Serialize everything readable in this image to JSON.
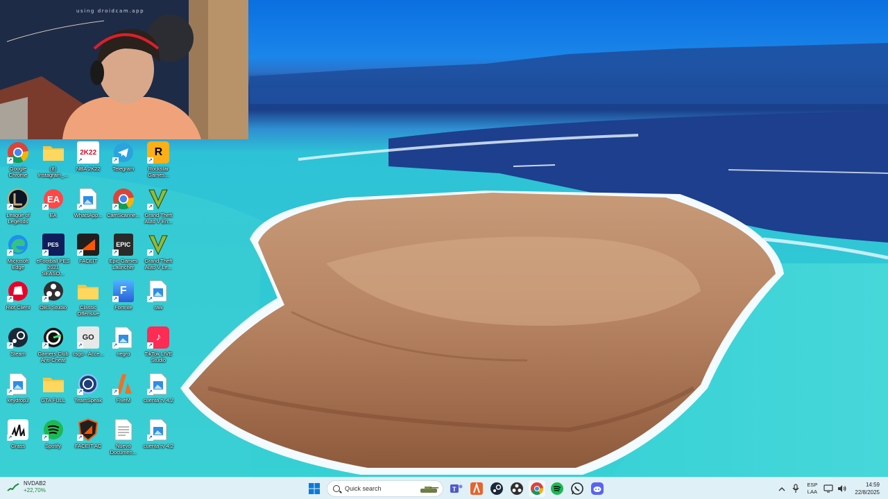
{
  "webcam": {
    "caption": "using droidcam.app"
  },
  "desktop_icons": [
    {
      "label": "Google Chrome",
      "icon": "chrome-icon"
    },
    {
      "label": "(8) Instagram_...",
      "icon": "folder-icon"
    },
    {
      "label": "NBA 2K22",
      "icon": "nba2k22-icon"
    },
    {
      "label": "Telegram",
      "icon": "telegram-icon"
    },
    {
      "label": "Rockstar Games...",
      "icon": "rockstar-icon"
    },
    {
      "label": "League of Legends",
      "icon": "league-of-legends-icon"
    },
    {
      "label": "EA",
      "icon": "ea-icon"
    },
    {
      "label": "WhatsApp...",
      "icon": "image-file-icon"
    },
    {
      "label": "CamScanne...",
      "icon": "chrome-icon"
    },
    {
      "label": "Grand Theft Auto V En...",
      "icon": "gta-v-icon"
    },
    {
      "label": "Microsoft Edge",
      "icon": "edge-icon"
    },
    {
      "label": "eFootball PES 2021 SEASO...",
      "icon": "pes-icon"
    },
    {
      "label": "FACEIT",
      "icon": "faceit-icon"
    },
    {
      "label": "Epic Games Launcher",
      "icon": "epic-games-icon"
    },
    {
      "label": "Grand Theft Auto V Le...",
      "icon": "gta-v-icon"
    },
    {
      "label": "Riot Client",
      "icon": "riot-icon"
    },
    {
      "label": "OBS Studio",
      "icon": "obs-icon"
    },
    {
      "label": "Classic Offensive",
      "icon": "folder-icon"
    },
    {
      "label": "Fortnite",
      "icon": "fortnite-icon"
    },
    {
      "label": "raw",
      "icon": "image-file-icon"
    },
    {
      "label": "Steam",
      "icon": "steam-icon"
    },
    {
      "label": "Gamers Club Anti-Cheat",
      "icon": "gamers-club-icon"
    },
    {
      "label": "csgo - Acce...",
      "icon": "csgo-icon"
    },
    {
      "label": "negro",
      "icon": "image-file-icon"
    },
    {
      "label": "TikTok LIVE Studio",
      "icon": "tiktok-icon"
    },
    {
      "label": "keydrop3",
      "icon": "image-file-icon"
    },
    {
      "label": "GTA FULL",
      "icon": "folder-icon"
    },
    {
      "label": "TeamSpeak",
      "icon": "teamspeak-icon"
    },
    {
      "label": "FiveM",
      "icon": "fivem-icon"
    },
    {
      "label": "cuenta rv 4.2",
      "icon": "image-file-icon"
    },
    {
      "label": "Grass",
      "icon": "grass-icon"
    },
    {
      "label": "Spotify",
      "icon": "spotify-icon"
    },
    {
      "label": "FACEIT AC",
      "icon": "faceit-ac-icon"
    },
    {
      "label": "Nuevo Documen...",
      "icon": "text-document-icon"
    },
    {
      "label": "cuenta rv 4.2",
      "icon": "image-file-icon"
    }
  ],
  "taskbar": {
    "widget": {
      "name": "NVDAB2",
      "change": "+22,70%"
    },
    "search_placeholder": "Quick search",
    "pinned": [
      "windows-start-icon",
      "teams-icon",
      "office-icon",
      "steam-icon",
      "obs-icon",
      "chrome-icon",
      "spotify-icon",
      "whatsapp-icon",
      "discord-icon"
    ],
    "language": {
      "line1": "ESP",
      "line2": "LAA"
    },
    "clock": {
      "time": "14:59",
      "date": "22/8/2025"
    }
  },
  "colors": {
    "taskbar_bg": "#dff0f6",
    "widget_change": "#1a8a3a",
    "sea": "#2dc2d6"
  }
}
